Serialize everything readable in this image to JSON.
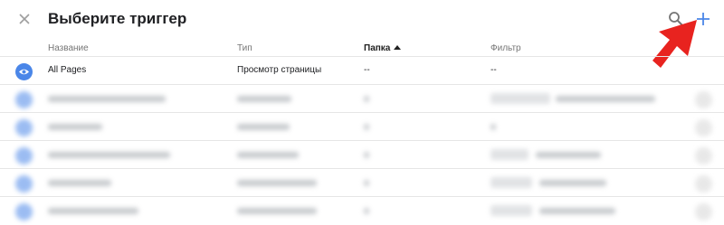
{
  "dialog": {
    "title": "Выберите триггер",
    "close_icon": "close-icon",
    "search_icon": "search-icon",
    "add_icon": "plus-icon"
  },
  "columns": {
    "name": "Название",
    "type": "Тип",
    "folder": "Папка",
    "filter": "Фильтр"
  },
  "rows": [
    {
      "icon": "eye-icon",
      "name": "All Pages",
      "type": "Просмотр страницы",
      "folder": "--",
      "filter": "--"
    }
  ],
  "colors": {
    "accent": "#4a86e8",
    "annotation_arrow": "#e8231f"
  }
}
